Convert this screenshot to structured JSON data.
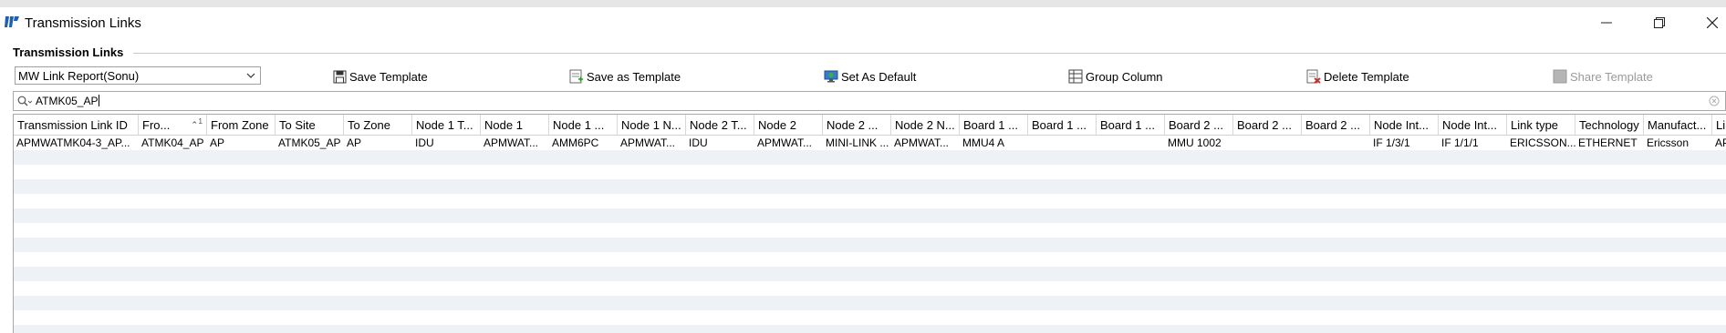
{
  "window": {
    "title": "Transmission Links",
    "controls": [
      "minimize",
      "restore",
      "close"
    ]
  },
  "section": {
    "label": "Transmission Links"
  },
  "toolbar": {
    "template_select": "MW Link Report(Sonu)",
    "save_template": "Save Template",
    "save_as_template": "Save as Template",
    "set_as_default": "Set As Default",
    "group_column": "Group Column",
    "delete_template": "Delete Template",
    "share_template": "Share Template"
  },
  "search": {
    "value": "ATMK05_AP"
  },
  "grid": {
    "sort": {
      "column_index": 1,
      "direction": "ascending",
      "order": "1"
    },
    "columns": [
      "Transmission Link ID",
      "Fro...",
      "From Zone",
      "To Site",
      "To Zone",
      "Node 1 T...",
      "Node 1",
      "Node 1 ...",
      "Node 1 N...",
      "Node 2 T...",
      "Node 2",
      "Node 2 ...",
      "Node 2 N...",
      "Board 1 ...",
      "Board 1 ...",
      "Board 1 ...",
      "Board 2 ...",
      "Board 2 ...",
      "Board 2 ...",
      "Node Int...",
      "Node Int...",
      "Link type",
      "Technology",
      "Manufact...",
      "Li"
    ],
    "rows": [
      [
        "APMWATMK04-3_AP...",
        "ATMK04_AP",
        "AP",
        "ATMK05_AP",
        "AP",
        "IDU",
        "APMWAT...",
        "AMM6PC",
        "APMWAT...",
        "IDU",
        "APMWAT...",
        "MINI-LINK ...",
        "APMWAT...",
        "MMU4 A",
        "",
        "",
        "MMU 1002",
        "",
        "",
        "IF 1/3/1",
        "IF 1/1/1",
        "ERICSSON...",
        "ETHERNET",
        "Ericsson",
        "AP"
      ]
    ]
  }
}
